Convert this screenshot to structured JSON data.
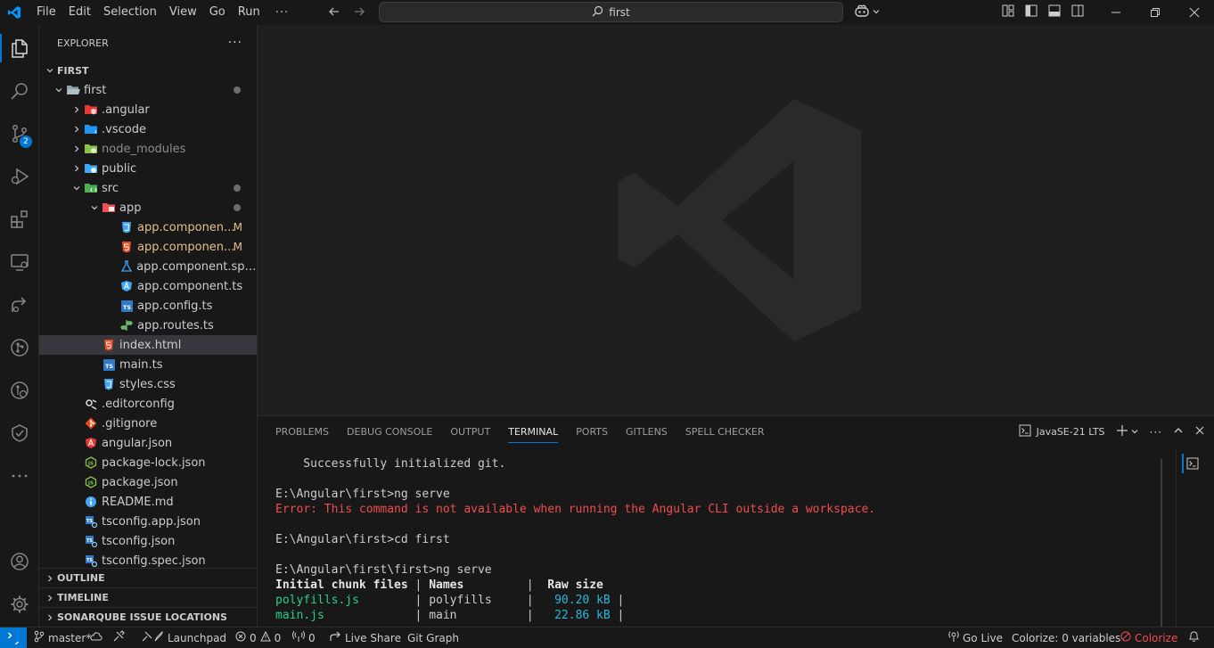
{
  "titlebar": {
    "menu": [
      "File",
      "Edit",
      "Selection",
      "View",
      "Go",
      "Run"
    ],
    "more": "···",
    "search_text": "first"
  },
  "activity": {
    "scm_badge": "2"
  },
  "explorer": {
    "header": "EXPLORER",
    "more": "···",
    "root": "FIRST",
    "items": [
      {
        "label": "first",
        "icon": "folder-open-icon"
      },
      {
        "label": ".angular",
        "icon": "folder-angular-icon"
      },
      {
        "label": ".vscode",
        "icon": "folder-vscode-icon"
      },
      {
        "label": "node_modules",
        "icon": "folder-node-icon"
      },
      {
        "label": "public",
        "icon": "folder-public-icon"
      },
      {
        "label": "src",
        "icon": "folder-src-icon"
      },
      {
        "label": "app",
        "icon": "folder-app-icon"
      },
      {
        "label": "app.componen...",
        "icon": "css-file-icon",
        "decoration": "M"
      },
      {
        "label": "app.componen...",
        "icon": "html-file-icon",
        "decoration": "M"
      },
      {
        "label": "app.component.spe...",
        "icon": "test-file-icon"
      },
      {
        "label": "app.component.ts",
        "icon": "angular-file-icon"
      },
      {
        "label": "app.config.ts",
        "icon": "ts-file-icon"
      },
      {
        "label": "app.routes.ts",
        "icon": "routes-file-icon"
      },
      {
        "label": "index.html",
        "icon": "html-file-icon"
      },
      {
        "label": "main.ts",
        "icon": "ts-file-icon"
      },
      {
        "label": "styles.css",
        "icon": "css-file-icon"
      },
      {
        "label": ".editorconfig",
        "icon": "editorconfig-file-icon"
      },
      {
        "label": ".gitignore",
        "icon": "git-file-icon"
      },
      {
        "label": "angular.json",
        "icon": "angular-file-icon"
      },
      {
        "label": "package-lock.json",
        "icon": "nodejs-file-icon"
      },
      {
        "label": "package.json",
        "icon": "nodejs-file-icon"
      },
      {
        "label": "README.md",
        "icon": "info-file-icon"
      },
      {
        "label": "tsconfig.app.json",
        "icon": "tsconfig-file-icon"
      },
      {
        "label": "tsconfig.json",
        "icon": "tsconfig-file-icon"
      },
      {
        "label": "tsconfig.spec.json",
        "icon": "tsconfig-file-icon"
      }
    ],
    "sections": [
      "OUTLINE",
      "TIMELINE",
      "SONARQUBE ISSUE LOCATIONS"
    ]
  },
  "panel": {
    "tabs": [
      "PROBLEMS",
      "DEBUG CONSOLE",
      "OUTPUT",
      "TERMINAL",
      "PORTS",
      "GITLENS",
      "SPELL CHECKER"
    ],
    "active_tab": "TERMINAL",
    "terminal_name": "JavaSE-21 LTS",
    "more": "···"
  },
  "terminal": {
    "line1": "    Successfully initialized git.",
    "line2": "E:\\Angular\\first>ng serve",
    "line3": "Error: This command is not available when running the Angular CLI outside a workspace.",
    "line4": "E:\\Angular\\first>cd first",
    "line5": "E:\\Angular\\first\\first>ng serve",
    "table_header": [
      "Initial chunk files",
      "Names",
      "Raw size"
    ],
    "rows": [
      {
        "file": "polyfills.js",
        "name": "polyfills",
        "size": "90.20 kB"
      },
      {
        "file": "main.js",
        "name": "main",
        "size": "22.86 kB"
      }
    ]
  },
  "statusbar": {
    "branch": "master*",
    "launchpad": "Launchpad",
    "errors": "0",
    "warnings": "0",
    "ports": "0",
    "live_share": "Live Share",
    "git_graph": "Git Graph",
    "go_live": "Go Live",
    "colorize_vars": "Colorize: 0 variables",
    "colorize": "Colorize"
  }
}
